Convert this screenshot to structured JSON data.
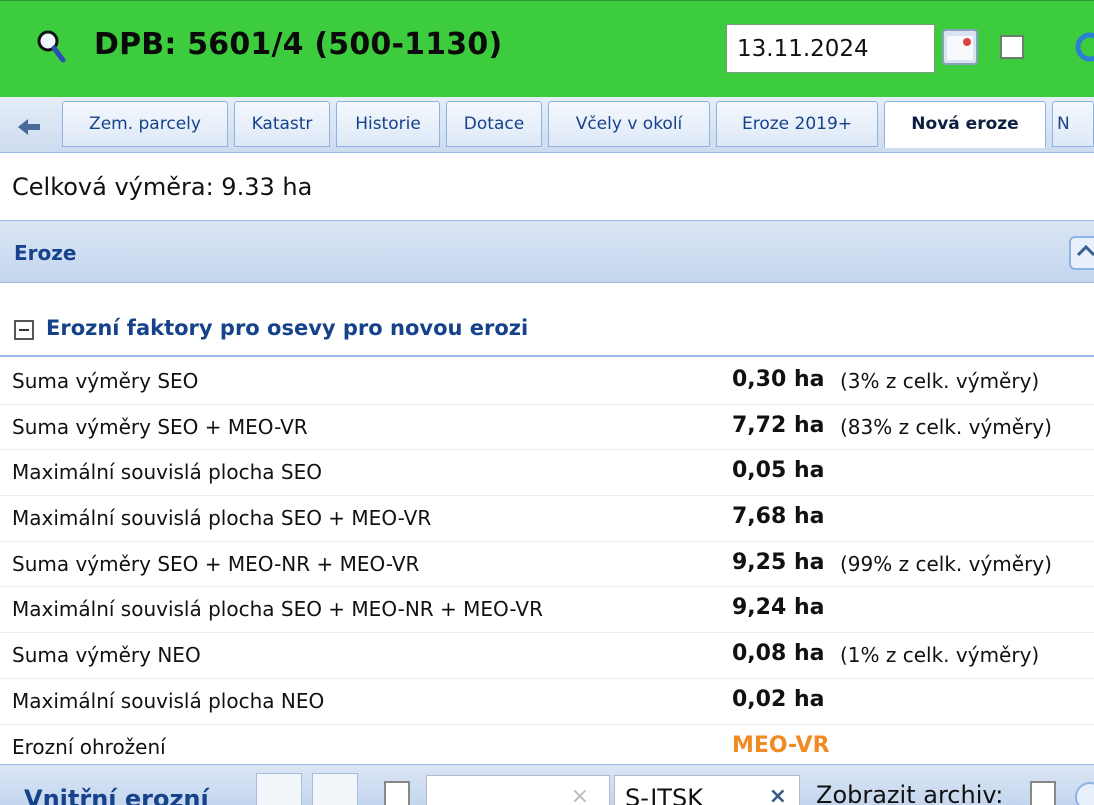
{
  "header": {
    "title": "DPB: 5601/4 (500-1130)",
    "date_value": "13.11.2024",
    "accent_color": "#3dcc3d"
  },
  "tabs": [
    {
      "label": "Zem. parcely"
    },
    {
      "label": "Katastr"
    },
    {
      "label": "Historie"
    },
    {
      "label": "Dotace"
    },
    {
      "label": "Včely v okolí"
    },
    {
      "label": "Eroze 2019+"
    },
    {
      "label": "Nová eroze",
      "active": true
    },
    {
      "label": "N"
    }
  ],
  "summary": {
    "total_area": "Celková výměra: 9.33 ha"
  },
  "panel": {
    "title": "Eroze"
  },
  "fieldset": {
    "legend": "Erozní faktory pro osevy pro novou erozi"
  },
  "rows": [
    {
      "label": "Suma výměry SEO",
      "value": "0,30 ha",
      "note": "(3% z celk. výměry)"
    },
    {
      "label": "Suma výměry SEO + MEO-VR",
      "value": "7,72 ha",
      "note": "(83% z celk. výměry)"
    },
    {
      "label": "Maximální souvislá plocha SEO",
      "value": "0,05 ha",
      "note": ""
    },
    {
      "label": "Maximální souvislá plocha SEO + MEO-VR",
      "value": "7,68 ha",
      "note": ""
    },
    {
      "label": "Suma výměry SEO + MEO-NR + MEO-VR",
      "value": "9,25 ha",
      "note": "(99% z celk. výměry)"
    },
    {
      "label": "Maximální souvislá plocha SEO + MEO-NR + MEO-VR",
      "value": "9,24 ha",
      "note": ""
    },
    {
      "label": "Suma výměry NEO",
      "value": "0,08 ha",
      "note": "(1% z celk. výměry)"
    },
    {
      "label": "Maximální souvislá plocha NEO",
      "value": "0,02 ha",
      "note": ""
    },
    {
      "label": "Erozní ohrožení",
      "value": "MEO-VR",
      "note": "",
      "warn": true
    }
  ],
  "bottom_toolbar": {
    "title": "Vnitřní erozní",
    "coord_system": "S-JTSK",
    "archive_label": "Zobrazit archiv:"
  },
  "colors": {
    "warn": "#f08a24",
    "panel_title": "#15428b"
  }
}
